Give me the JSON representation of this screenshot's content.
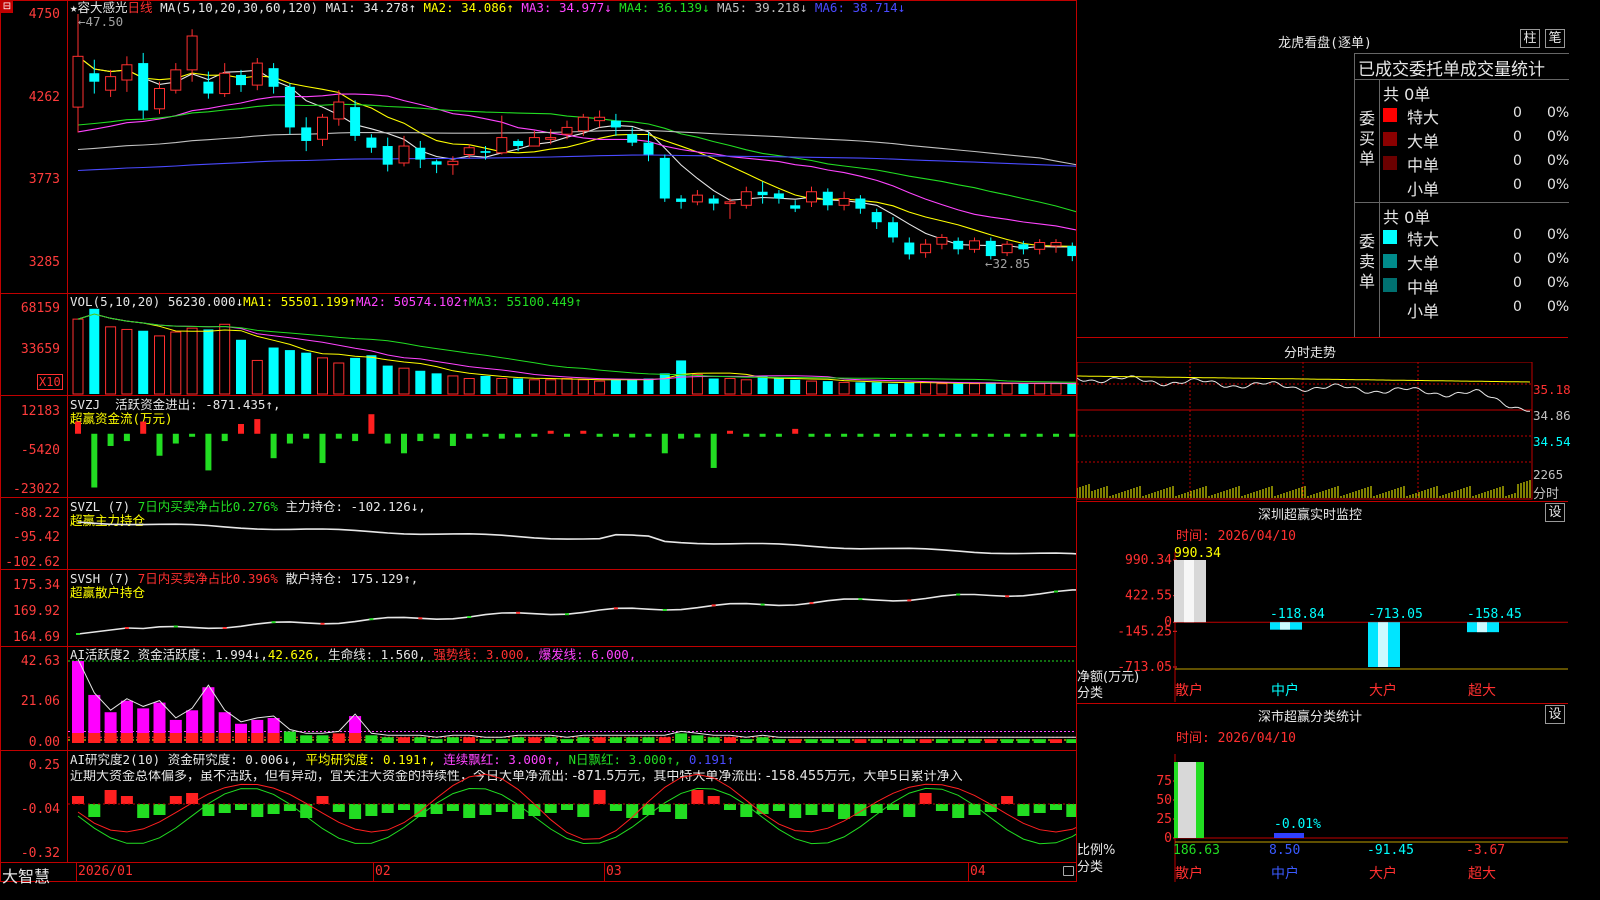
{
  "header": {
    "stock_name": "★容大感光",
    "period": "日线",
    "ma_label": "MA(5,10,20,30,60,120)",
    "ma": [
      {
        "label": "MA1: 34.278",
        "arrow": "↑",
        "color": "#e6e6e6"
      },
      {
        "label": "MA2: 34.086",
        "arrow": "↑",
        "color": "#ffff00"
      },
      {
        "label": "MA3: 34.977",
        "arrow": "↓",
        "color": "#ff44ff"
      },
      {
        "label": "MA4: 36.139",
        "arrow": "↓",
        "color": "#22dd22"
      },
      {
        "label": "MA5: 39.218",
        "arrow": "↓",
        "color": "#c0c0c0"
      },
      {
        "label": "MA6: 38.714",
        "arrow": "↓",
        "color": "#4a4aff"
      }
    ],
    "high_mark": "47.50",
    "low_mark": "32.85",
    "y_ticks": [
      "4750",
      "4262",
      "3773",
      "3285"
    ]
  },
  "volume": {
    "label": "VOL(5,10,20)",
    "value": "56230.000↓",
    "ma1": "MA1: 55501.199↑",
    "ma2": "MA2: 50574.102↑",
    "ma3": "MA3: 55100.449↑",
    "y_ticks": [
      "68159",
      "33659"
    ],
    "unit": "X10"
  },
  "svzj": {
    "label": "SVZJ",
    "text1": "活跃资金进出: -871.435↑,",
    "text2": "超赢资金流(万元)",
    "y_ticks": [
      "12183",
      "-5420",
      "-23022"
    ]
  },
  "svzl": {
    "label": "SVZL (7)",
    "text1": "7日内买卖净占比0.276%",
    "text2": "主力持仓: -102.126↓,",
    "text3": "超赢主力持仓",
    "y_ticks": [
      "-88.22",
      "-95.42",
      "-102.62"
    ]
  },
  "svsh": {
    "label": "SVSH (7)",
    "text1": "7日内买卖净占比0.396%",
    "text2": "散户持仓: 175.129↑,",
    "text3": "超赢散户持仓",
    "y_ticks": [
      "175.34",
      "169.92",
      "164.69"
    ]
  },
  "ai_active": {
    "label": "AI活跃度2",
    "t1": "资金活跃度: 1.994↓,",
    "t2": "42.626,",
    "t3": "生命线: 1.560,",
    "t4": "强势线: 3.000,",
    "t5": "爆发线: 6.000,",
    "y_ticks": [
      "42.63",
      "21.06",
      "0.00"
    ]
  },
  "ai_research": {
    "label": "AI研究度2(10)",
    "t1": "资金研究度: 0.006↓,",
    "t2": "平均研究度: 0.191↑,",
    "t3": "连续飘红: 3.000↑,",
    "t4": "N日飘红: 3.000↑,",
    "t5": "0.191↑",
    "comment": "近期大资金总体偏多，虽不活跃，但有异动，宜关注大资金的持续性，今日大单净流出: -871.5万元，其中特大单净流出: -158.455万元，大单5日累计净入",
    "y_ticks": [
      "0.25",
      "-0.04",
      "-0.32"
    ]
  },
  "x_axis": [
    "2026/01",
    "02",
    "03",
    "04"
  ],
  "brand": "大智慧",
  "right": {
    "title": "龙虎看盘(逐单)",
    "btn1": "柱",
    "btn2": "笔",
    "header": "已成交委托单成交量统计",
    "buy": {
      "side": "委买单",
      "total": "共 0单",
      "rows": [
        {
          "name": "特大",
          "v": "0",
          "p": "0%",
          "color": "#ff0000"
        },
        {
          "name": "大单",
          "v": "0",
          "p": "0%",
          "color": "#8b0000"
        },
        {
          "name": "中单",
          "v": "0",
          "p": "0%",
          "color": "#6b0000"
        },
        {
          "name": "小单",
          "v": "0",
          "p": "0%",
          "color": "#000000"
        }
      ]
    },
    "sell": {
      "side": "委卖单",
      "total": "共 0单",
      "rows": [
        {
          "name": "特大",
          "v": "0",
          "p": "0%",
          "color": "#00ffff"
        },
        {
          "name": "大单",
          "v": "0",
          "p": "0%",
          "color": "#008b8b"
        },
        {
          "name": "中单",
          "v": "0",
          "p": "0%",
          "color": "#007070"
        },
        {
          "name": "小单",
          "v": "0",
          "p": "0%",
          "color": "#000000"
        }
      ]
    },
    "intraday": {
      "title": "分时走势",
      "ticks": [
        "35.18",
        "34.86",
        "34.54"
      ],
      "vol_tick": "2265",
      "vol_label": "分时"
    },
    "monitor": {
      "title": "深圳超赢实时监控",
      "btn": "设",
      "time": "时间: 2026/04/10",
      "ticks": [
        "990.34",
        "422.55",
        "0",
        "-145.25",
        "-713.05"
      ],
      "unit1": "净额(万元)",
      "unit2": "分类",
      "categories": [
        "散户",
        "中户",
        "大户",
        "超大"
      ],
      "values": [
        990.34,
        -118.84,
        -713.05,
        -158.45
      ],
      "value_labels": [
        "990.34",
        "-118.84",
        "-713.05",
        "-158.45"
      ]
    },
    "classify": {
      "title": "深市超赢分类统计",
      "btn": "设",
      "time": "时间: 2026/04/10",
      "ticks": [
        "75",
        "50",
        "25",
        "0"
      ],
      "unit1": "比例%",
      "unit2": "分类",
      "categories": [
        "散户",
        "中户",
        "大户",
        "超大"
      ],
      "pct_label": "-0.01%",
      "bottom_values": [
        "186.63",
        "8.50",
        "-91.45",
        "-3.67"
      ]
    }
  },
  "chart_data": [
    {
      "type": "candlestick",
      "title": "容大感光 日线",
      "ylim": [
        32.85,
        47.5
      ],
      "candles": [
        [
          42.0,
          45.0,
          40.5,
          47.5
        ],
        [
          44.0,
          43.5,
          42.8,
          44.8
        ],
        [
          43.0,
          43.8,
          42.6,
          44.2
        ],
        [
          43.6,
          44.5,
          42.9,
          45.0
        ],
        [
          44.6,
          41.8,
          41.3,
          45.2
        ],
        [
          41.9,
          43.1,
          41.6,
          43.5
        ],
        [
          43.0,
          44.2,
          42.8,
          44.6
        ],
        [
          44.2,
          46.2,
          43.5,
          46.6
        ],
        [
          43.5,
          42.8,
          42.5,
          44.1
        ],
        [
          42.8,
          44.0,
          42.6,
          44.6
        ],
        [
          43.9,
          43.3,
          42.9,
          44.2
        ],
        [
          43.3,
          44.6,
          43.0,
          44.9
        ],
        [
          44.3,
          43.2,
          42.8,
          44.6
        ],
        [
          43.2,
          40.8,
          40.4,
          43.4
        ],
        [
          40.8,
          40.0,
          39.4,
          41.4
        ],
        [
          40.1,
          41.4,
          39.7,
          41.6
        ],
        [
          41.3,
          42.3,
          40.9,
          43.0
        ],
        [
          42.0,
          40.3,
          40.0,
          42.4
        ],
        [
          40.2,
          39.6,
          39.3,
          40.4
        ],
        [
          39.7,
          38.6,
          38.2,
          40.2
        ],
        [
          38.7,
          39.7,
          38.5,
          40.3
        ],
        [
          39.6,
          38.9,
          38.4,
          40.0
        ],
        [
          38.8,
          38.6,
          38.1,
          38.9
        ],
        [
          38.6,
          38.8,
          38.0,
          39.1
        ],
        [
          39.2,
          39.6,
          39.0,
          39.8
        ],
        [
          39.4,
          39.3,
          38.9,
          39.7
        ],
        [
          39.3,
          40.2,
          39.2,
          41.5
        ],
        [
          40.0,
          39.7,
          39.4,
          40.1
        ],
        [
          39.7,
          40.2,
          39.7,
          40.6
        ],
        [
          40.1,
          40.2,
          39.8,
          40.7
        ],
        [
          40.4,
          40.8,
          40.1,
          41.2
        ],
        [
          40.6,
          41.4,
          40.3,
          41.6
        ],
        [
          41.2,
          41.4,
          40.8,
          41.8
        ],
        [
          41.2,
          40.8,
          40.3,
          41.6
        ],
        [
          40.4,
          39.9,
          39.7,
          40.8
        ],
        [
          39.9,
          39.2,
          38.8,
          40.5
        ],
        [
          39.0,
          36.6,
          36.4,
          39.2
        ],
        [
          36.6,
          36.4,
          36.0,
          36.8
        ],
        [
          36.4,
          36.8,
          36.2,
          37.1
        ],
        [
          36.6,
          36.3,
          35.9,
          36.8
        ],
        [
          36.3,
          36.4,
          35.4,
          36.6
        ],
        [
          36.2,
          37.0,
          36.0,
          37.3
        ],
        [
          37.0,
          36.8,
          36.3,
          37.6
        ],
        [
          36.9,
          36.6,
          36.3,
          37.1
        ],
        [
          36.2,
          36.0,
          35.8,
          36.5
        ],
        [
          36.4,
          37.0,
          36.1,
          37.3
        ],
        [
          37.0,
          36.2,
          35.9,
          37.2
        ],
        [
          36.2,
          36.6,
          35.9,
          37.0
        ],
        [
          36.6,
          36.0,
          35.7,
          36.8
        ],
        [
          35.8,
          35.2,
          34.8,
          36.0
        ],
        [
          35.2,
          34.3,
          34.0,
          35.5
        ],
        [
          34.0,
          33.3,
          33.0,
          34.3
        ],
        [
          33.4,
          33.9,
          33.1,
          34.2
        ],
        [
          33.9,
          34.3,
          33.6,
          34.5
        ],
        [
          34.1,
          33.6,
          33.3,
          34.3
        ],
        [
          33.6,
          34.1,
          33.4,
          34.3
        ],
        [
          34.1,
          33.2,
          33.0,
          34.3
        ],
        [
          33.4,
          33.9,
          33.2,
          34.1
        ],
        [
          33.9,
          33.6,
          33.3,
          34.1
        ],
        [
          33.6,
          34.0,
          33.3,
          34.2
        ],
        [
          33.8,
          34.0,
          33.4,
          34.2
        ],
        [
          33.8,
          33.2,
          32.9,
          34.0
        ],
        [
          33.2,
          33.1,
          32.85,
          33.6
        ],
        [
          33.0,
          33.4,
          32.9,
          33.7
        ],
        [
          33.6,
          34.4,
          33.4,
          34.6
        ],
        [
          34.1,
          34.4,
          33.9,
          34.6
        ],
        [
          34.3,
          34.5,
          33.9,
          34.8
        ],
        [
          34.6,
          34.3,
          34.1,
          34.7
        ]
      ]
    },
    {
      "type": "bar",
      "title": "VOL(5,10,20)",
      "ylim": [
        0,
        68159
      ],
      "values": [
        58000,
        66000,
        52000,
        50000,
        49000,
        45000,
        48000,
        51000,
        50000,
        54000,
        42000,
        26000,
        36000,
        34000,
        32000,
        28000,
        24000,
        28000,
        30000,
        22000,
        20000,
        18000,
        16000,
        14000,
        12000,
        14000,
        12000,
        12000,
        11000,
        11000,
        12000,
        11000,
        10000,
        11000,
        11000,
        12000,
        16000,
        26000,
        15000,
        12000,
        12000,
        11000,
        14000,
        12000,
        11000,
        10000,
        10000,
        9000,
        9000,
        9000,
        8000,
        9000,
        9000,
        8000,
        8000,
        8000,
        9000,
        8000,
        8000,
        8000,
        8000,
        8000,
        8000,
        9000,
        11000,
        10000,
        9000,
        10000
      ]
    },
    {
      "type": "bar",
      "title": "超赢资金流(万元)",
      "ylim": [
        -23022,
        12183
      ],
      "values": [
        5000,
        -22000,
        -5000,
        -3000,
        5000,
        -9000,
        -4000,
        -1000,
        -15000,
        -3000,
        4000,
        6000,
        -10000,
        -4000,
        -2000,
        -12000,
        -2000,
        -3000,
        8000,
        -4000,
        -8000,
        -3000,
        -2000,
        -5000,
        -2000,
        -1000,
        -2000,
        -1500,
        -1000,
        1000,
        -1000,
        1000,
        -1000,
        -1000,
        -1500,
        -1200,
        -8000,
        -2000,
        -1500,
        -14000,
        1000,
        -1000,
        -1000,
        -1000,
        2000,
        -1000,
        -1000,
        -1000,
        -1000,
        -1000,
        -1000,
        -1000,
        -1200,
        -1000,
        -1000,
        -800,
        -800,
        -800,
        -800,
        -800,
        -800,
        -800,
        -900,
        -800,
        -800,
        -900,
        3000,
        -1000,
        -871
      ]
    },
    {
      "type": "bar",
      "title": "AI活跃度2",
      "ylim": [
        0,
        42.63
      ],
      "values": [
        42.6,
        25,
        16,
        22,
        18,
        21,
        12,
        17,
        29,
        16,
        10,
        12,
        13,
        6,
        4,
        4,
        5,
        14,
        4,
        3,
        3,
        3,
        2,
        3,
        3,
        2,
        2,
        3,
        3,
        3,
        2,
        3,
        3,
        3,
        3,
        3,
        3,
        5,
        4,
        3,
        3,
        2,
        3,
        2,
        2,
        2,
        2,
        2,
        2,
        2,
        2,
        2,
        2,
        2,
        2,
        2,
        2,
        2,
        2,
        2,
        2,
        2,
        2,
        2,
        2,
        2,
        3,
        2,
        2
      ]
    },
    {
      "type": "bar",
      "title": "深圳超赢实时监控",
      "categories": [
        "散户",
        "中户",
        "大户",
        "超大"
      ],
      "values": [
        990.34,
        -118.84,
        -713.05,
        -158.45
      ],
      "ylim": [
        -713.05,
        990.34
      ]
    }
  ]
}
